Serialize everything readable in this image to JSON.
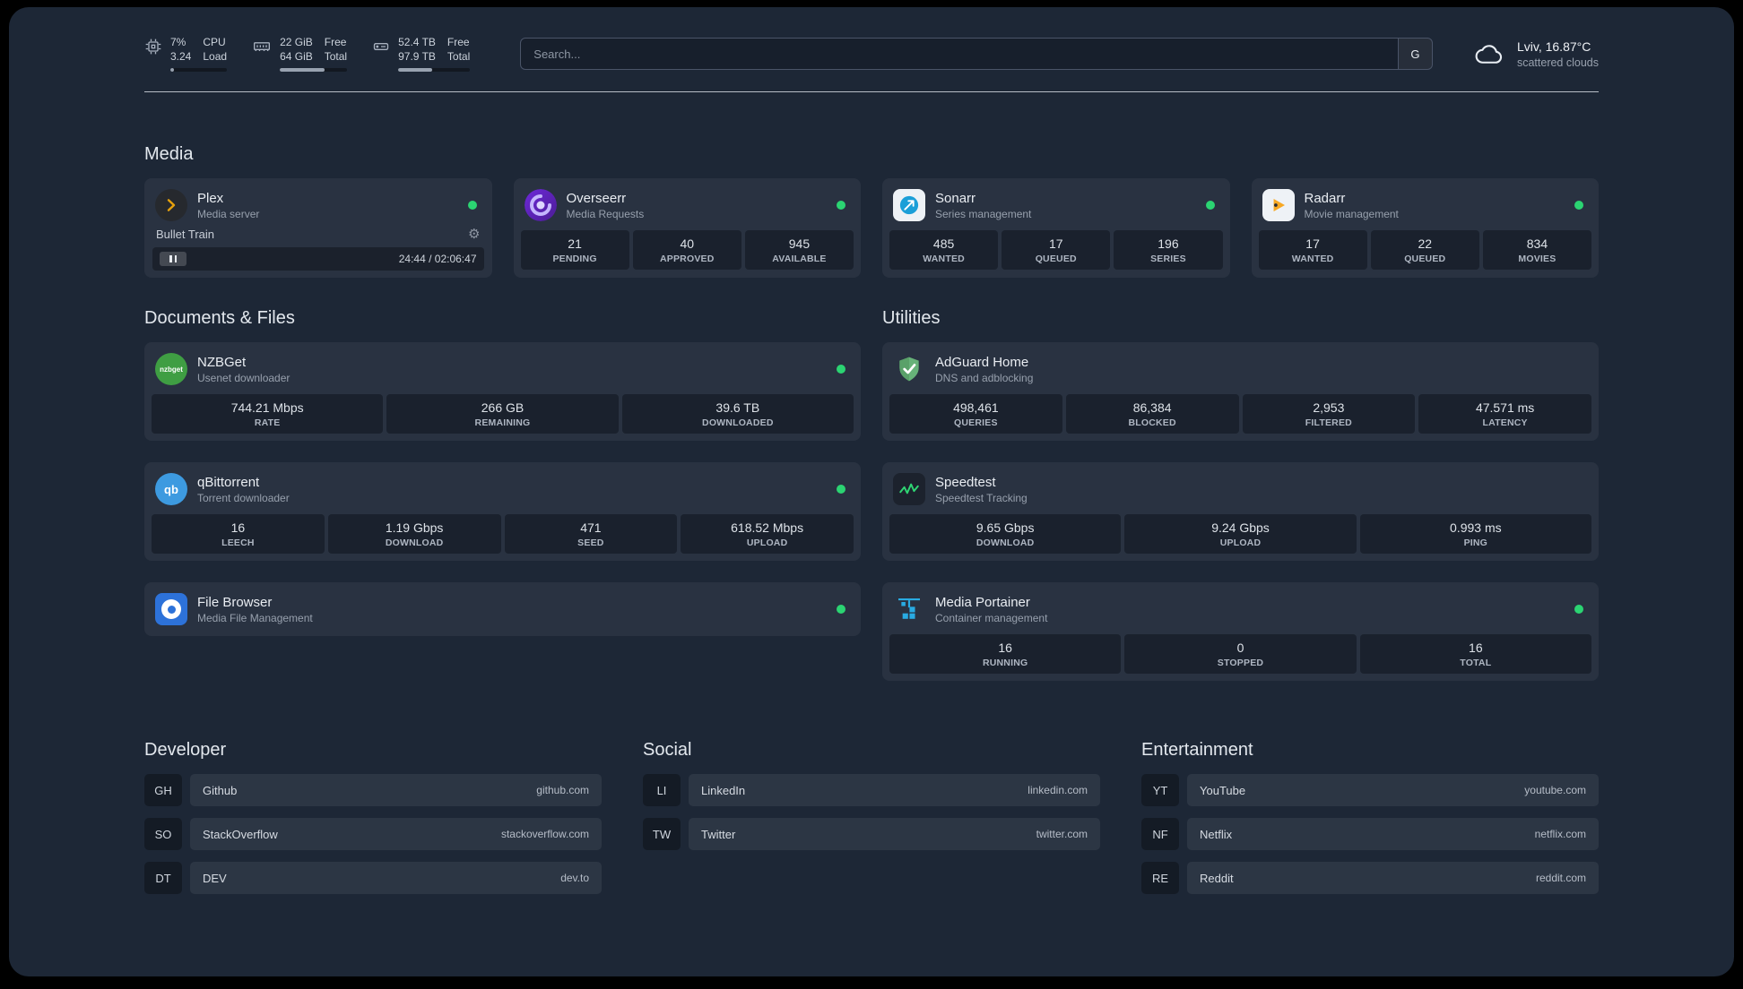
{
  "topbar": {
    "cpu": {
      "value_top": "7%",
      "value_bottom": "3.24",
      "label_top": "CPU",
      "label_bottom": "Load",
      "bar_percent": 7
    },
    "memory": {
      "value_top": "22 GiB",
      "value_bottom": "64 GiB",
      "label_top": "Free",
      "label_bottom": "Total",
      "bar_percent": 66
    },
    "disk": {
      "value_top": "52.4 TB",
      "value_bottom": "97.9 TB",
      "label_top": "Free",
      "label_bottom": "Total",
      "bar_percent": 47
    },
    "search": {
      "placeholder": "Search...",
      "provider": "G"
    },
    "weather": {
      "location": "Lviv, 16.87°C",
      "condition": "scattered clouds"
    }
  },
  "sections": {
    "media": {
      "heading": "Media"
    },
    "documents": {
      "heading": "Documents & Files"
    },
    "utilities": {
      "heading": "Utilities"
    }
  },
  "services": {
    "plex": {
      "title": "Plex",
      "subtitle": "Media server",
      "now_playing": "Bullet Train",
      "timestamp": "24:44 / 02:06:47"
    },
    "overseerr": {
      "title": "Overseerr",
      "subtitle": "Media Requests",
      "stats": [
        {
          "value": "21",
          "label": "PENDING"
        },
        {
          "value": "40",
          "label": "APPROVED"
        },
        {
          "value": "945",
          "label": "AVAILABLE"
        }
      ]
    },
    "sonarr": {
      "title": "Sonarr",
      "subtitle": "Series management",
      "stats": [
        {
          "value": "485",
          "label": "WANTED"
        },
        {
          "value": "17",
          "label": "QUEUED"
        },
        {
          "value": "196",
          "label": "SERIES"
        }
      ]
    },
    "radarr": {
      "title": "Radarr",
      "subtitle": "Movie management",
      "stats": [
        {
          "value": "17",
          "label": "WANTED"
        },
        {
          "value": "22",
          "label": "QUEUED"
        },
        {
          "value": "834",
          "label": "MOVIES"
        }
      ]
    },
    "nzbget": {
      "title": "NZBGet",
      "subtitle": "Usenet downloader",
      "stats": [
        {
          "value": "744.21 Mbps",
          "label": "RATE"
        },
        {
          "value": "266 GB",
          "label": "REMAINING"
        },
        {
          "value": "39.6 TB",
          "label": "DOWNLOADED"
        }
      ]
    },
    "qbittorrent": {
      "title": "qBittorrent",
      "subtitle": "Torrent downloader",
      "stats": [
        {
          "value": "16",
          "label": "LEECH"
        },
        {
          "value": "1.19 Gbps",
          "label": "DOWNLOAD"
        },
        {
          "value": "471",
          "label": "SEED"
        },
        {
          "value": "618.52 Mbps",
          "label": "UPLOAD"
        }
      ]
    },
    "filebrowser": {
      "title": "File Browser",
      "subtitle": "Media File Management"
    },
    "adguard": {
      "title": "AdGuard Home",
      "subtitle": "DNS and adblocking",
      "stats": [
        {
          "value": "498,461",
          "label": "QUERIES"
        },
        {
          "value": "86,384",
          "label": "BLOCKED"
        },
        {
          "value": "2,953",
          "label": "FILTERED"
        },
        {
          "value": "47.571 ms",
          "label": "LATENCY"
        }
      ]
    },
    "speedtest": {
      "title": "Speedtest",
      "subtitle": "Speedtest Tracking",
      "stats": [
        {
          "value": "9.65 Gbps",
          "label": "DOWNLOAD"
        },
        {
          "value": "9.24 Gbps",
          "label": "UPLOAD"
        },
        {
          "value": "0.993 ms",
          "label": "PING"
        }
      ]
    },
    "portainer": {
      "title": "Media Portainer",
      "subtitle": "Container management",
      "stats": [
        {
          "value": "16",
          "label": "RUNNING"
        },
        {
          "value": "0",
          "label": "STOPPED"
        },
        {
          "value": "16",
          "label": "TOTAL"
        }
      ]
    }
  },
  "bookmarks": {
    "developer": {
      "heading": "Developer",
      "items": [
        {
          "abbr": "GH",
          "name": "Github",
          "domain": "github.com"
        },
        {
          "abbr": "SO",
          "name": "StackOverflow",
          "domain": "stackoverflow.com"
        },
        {
          "abbr": "DT",
          "name": "DEV",
          "domain": "dev.to"
        }
      ]
    },
    "social": {
      "heading": "Social",
      "items": [
        {
          "abbr": "LI",
          "name": "LinkedIn",
          "domain": "linkedin.com"
        },
        {
          "abbr": "TW",
          "name": "Twitter",
          "domain": "twitter.com"
        }
      ]
    },
    "entertainment": {
      "heading": "Entertainment",
      "items": [
        {
          "abbr": "YT",
          "name": "YouTube",
          "domain": "youtube.com"
        },
        {
          "abbr": "NF",
          "name": "Netflix",
          "domain": "netflix.com"
        },
        {
          "abbr": "RE",
          "name": "Reddit",
          "domain": "reddit.com"
        }
      ]
    }
  },
  "icons": {
    "nzbget_text": "nzbget",
    "qbittorrent_text": "qb",
    "gear_glyph": "⚙"
  },
  "colors": {
    "status_online": "#2bd472",
    "plex_amber": "#e5a00d"
  }
}
